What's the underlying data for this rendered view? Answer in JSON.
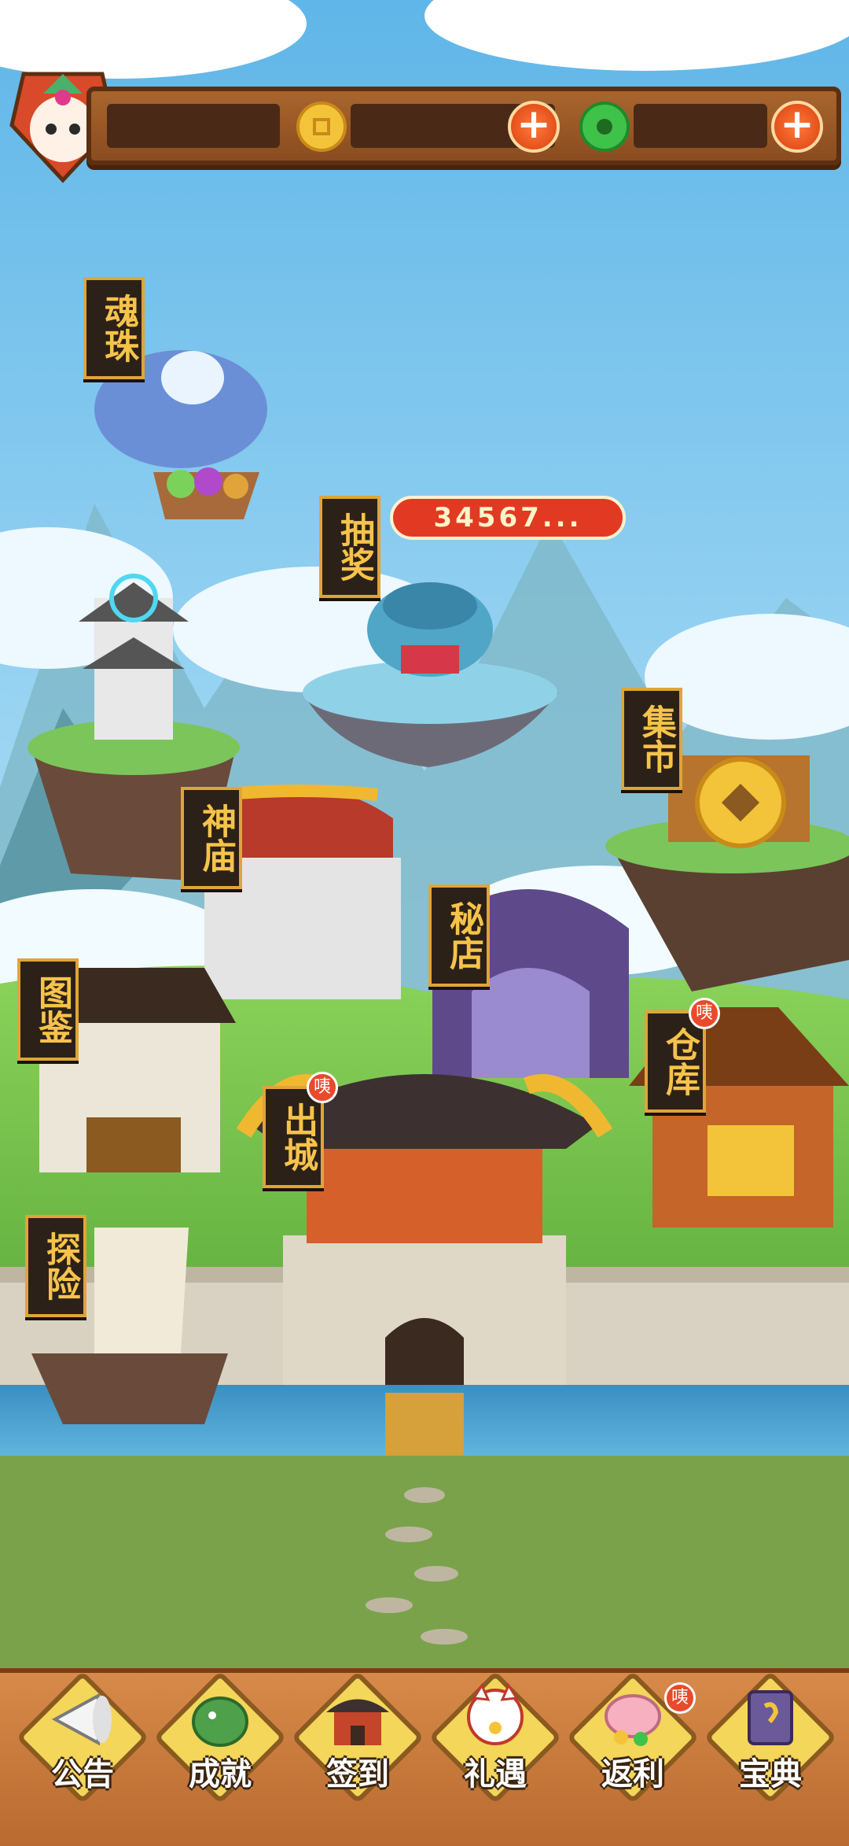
{
  "resources": {
    "coin_icon": "copper-coin-icon",
    "jade_icon": "jade-ring-icon",
    "add_label": "+"
  },
  "lottery_counter": "34567...",
  "buildings": {
    "soul_orb": "魂珠",
    "lottery": "抽奖",
    "temple": "神庙",
    "market": "集市",
    "handbook": "图鉴",
    "secret_shop": "秘店",
    "warehouse": "仓库",
    "leave_city": "出城",
    "explore": "探险"
  },
  "badge_text": "咦",
  "bottom_nav": {
    "notice": "公告",
    "achievement": "成就",
    "checkin": "签到",
    "gift": "礼遇",
    "rebate": "返利",
    "codex": "宝典"
  },
  "colors": {
    "label_bg": "#2c2118",
    "label_text": "#f6c34a",
    "badge": "#e84a2c",
    "bar": "#8a4c1f"
  }
}
